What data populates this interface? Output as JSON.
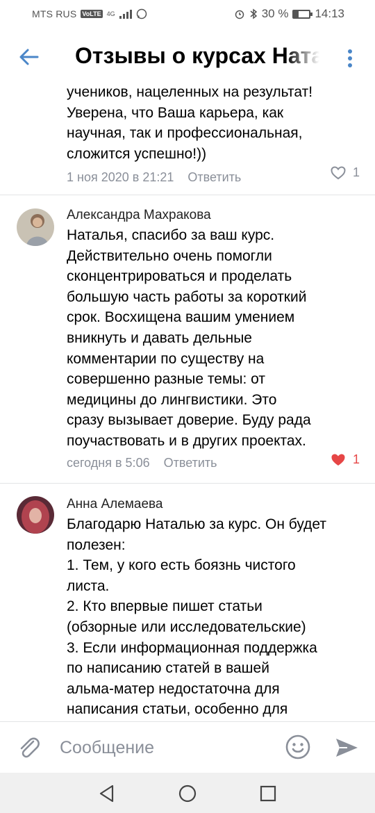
{
  "status_bar": {
    "carrier": "MTS RUS",
    "volte": "VoLTE",
    "network": "4G",
    "battery": "30 %",
    "battery_level": 0.3,
    "time": "14:13"
  },
  "header": {
    "title": "Отзывы о курсах Наталии"
  },
  "comments": [
    {
      "text": "учеников, нацеленных на результат!\nУверена, что Ваша карьера, как\nнаучная, так и профессиональная,\nсложится успешно!))",
      "date": "1 ноя 2020 в 21:21",
      "reply": "Ответить",
      "likes": "1",
      "liked": false
    },
    {
      "author": "Александра Махракова",
      "text": "Наталья, спасибо за ваш курс.\nДействительно очень помогли\nсконцентрироваться и проделать\nбольшую часть работы за короткий\nсрок. Восхищена вашим умением\nвникнуть и давать дельные\nкомментарии по существу на\nсовершенно разные темы: от\nмедицины до лингвистики. Это\nсразу вызывает доверие. Буду рада\nпоучаствовать и в других проектах.",
      "date": "сегодня в 5:06",
      "reply": "Ответить",
      "likes": "1",
      "liked": true
    },
    {
      "author": "Анна Алемаева",
      "text": "Благодарю Наталью за курс. Он будет\nполезен:\n1. Тем, у кого есть боязнь чистого\nлиста.\n2. Кто впервые пишет статьи\n(обзорные или исследовательские)\n3. Если информационная поддержка\nпо написанию статей в вашей\nальма-матер недостаточна для\nнаписания статьи, особенно для"
    }
  ],
  "composer": {
    "placeholder": "Сообщение"
  },
  "colors": {
    "accent": "#4a86c8",
    "secondary_text": "#8a8f99",
    "like_active": "#e64646",
    "divider": "#e3e4e6",
    "navbar_bg": "#f0f0f0"
  },
  "icons": {
    "back": "arrow-left-icon",
    "menu": "more-vertical-icon",
    "attach": "paperclip-icon",
    "emoji": "smile-icon",
    "send": "send-icon",
    "like_outline": "heart-outline-icon",
    "like_filled": "heart-filled-icon"
  }
}
